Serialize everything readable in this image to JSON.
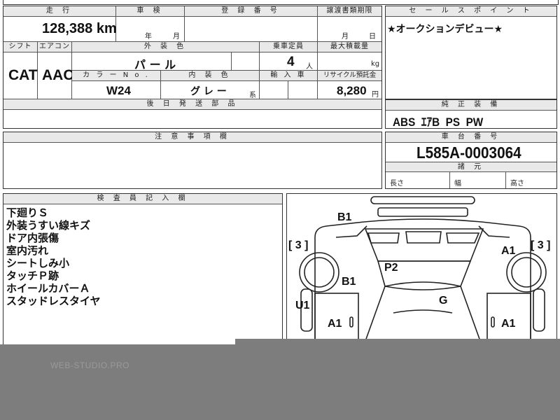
{
  "sheet": {
    "top_partial": "...",
    "mileage": {
      "header": "走 行",
      "value": "128,388",
      "unit": "km"
    },
    "inspection": {
      "header": "車 検",
      "year": "年",
      "month": "月"
    },
    "registration": {
      "header": "登 録 番 号"
    },
    "transfer_deadline": {
      "header": "譲渡書類期限",
      "month": "月",
      "day": "日"
    },
    "shift": {
      "header": "シフト",
      "value": "CAT"
    },
    "aircon": {
      "header": "エアコン",
      "value": "AAC"
    },
    "exterior_color": {
      "header": "外 装 色",
      "value": "パ ー ル"
    },
    "capacity": {
      "header": "乗車定員",
      "value": "4",
      "unit": "人"
    },
    "max_load": {
      "header": "最大積載量",
      "unit": "kg"
    },
    "color_no": {
      "header": "カ ラ ー N o .",
      "value": "W24"
    },
    "interior_color": {
      "header": "内 装 色",
      "value": "グ レ ー",
      "suffix": "系"
    },
    "import": {
      "header": "輸 入 車"
    },
    "recycle": {
      "header": "リサイクル預託金",
      "value": "8,280",
      "unit": "円"
    },
    "later_parts": {
      "header": "後 日 発 送 部 品"
    },
    "sales_point": {
      "header": "セ ー ル ス ポ イ ン ト",
      "text": "★オークションデビュー★"
    },
    "equipment": {
      "header": "純 正 装 備",
      "value": "ABS  ｴｱB  PS  PW"
    },
    "caution": {
      "header": "注 意 事 項 欄"
    },
    "chassis": {
      "header": "車 台 番 号",
      "value": "L585A-0003064"
    },
    "dimensions": {
      "header": "諸 元",
      "length": "長さ",
      "width": "幅",
      "height": "高さ"
    },
    "inspector": {
      "header": "検 査 員 記 入 欄",
      "notes": [
        "下廻りＳ",
        "外装うすい線キズ",
        "ドア内張傷",
        "室内汚れ",
        "シートしみ小",
        "タッチＰ跡",
        "ホイールカバーＡ",
        "スタッドレスタイヤ"
      ]
    },
    "diagram_labels": {
      "b1_top": "B1",
      "bracket_left": "[ 3 ]",
      "bracket_right": "[ 3 ]",
      "a1_right_top": "A1",
      "p2": "P2",
      "b1_left": "B1",
      "u1": "U1",
      "g": "G",
      "a1_left": "A1",
      "a1_right": "A1"
    },
    "watermark": "WEB-STUDIO.PRO"
  }
}
